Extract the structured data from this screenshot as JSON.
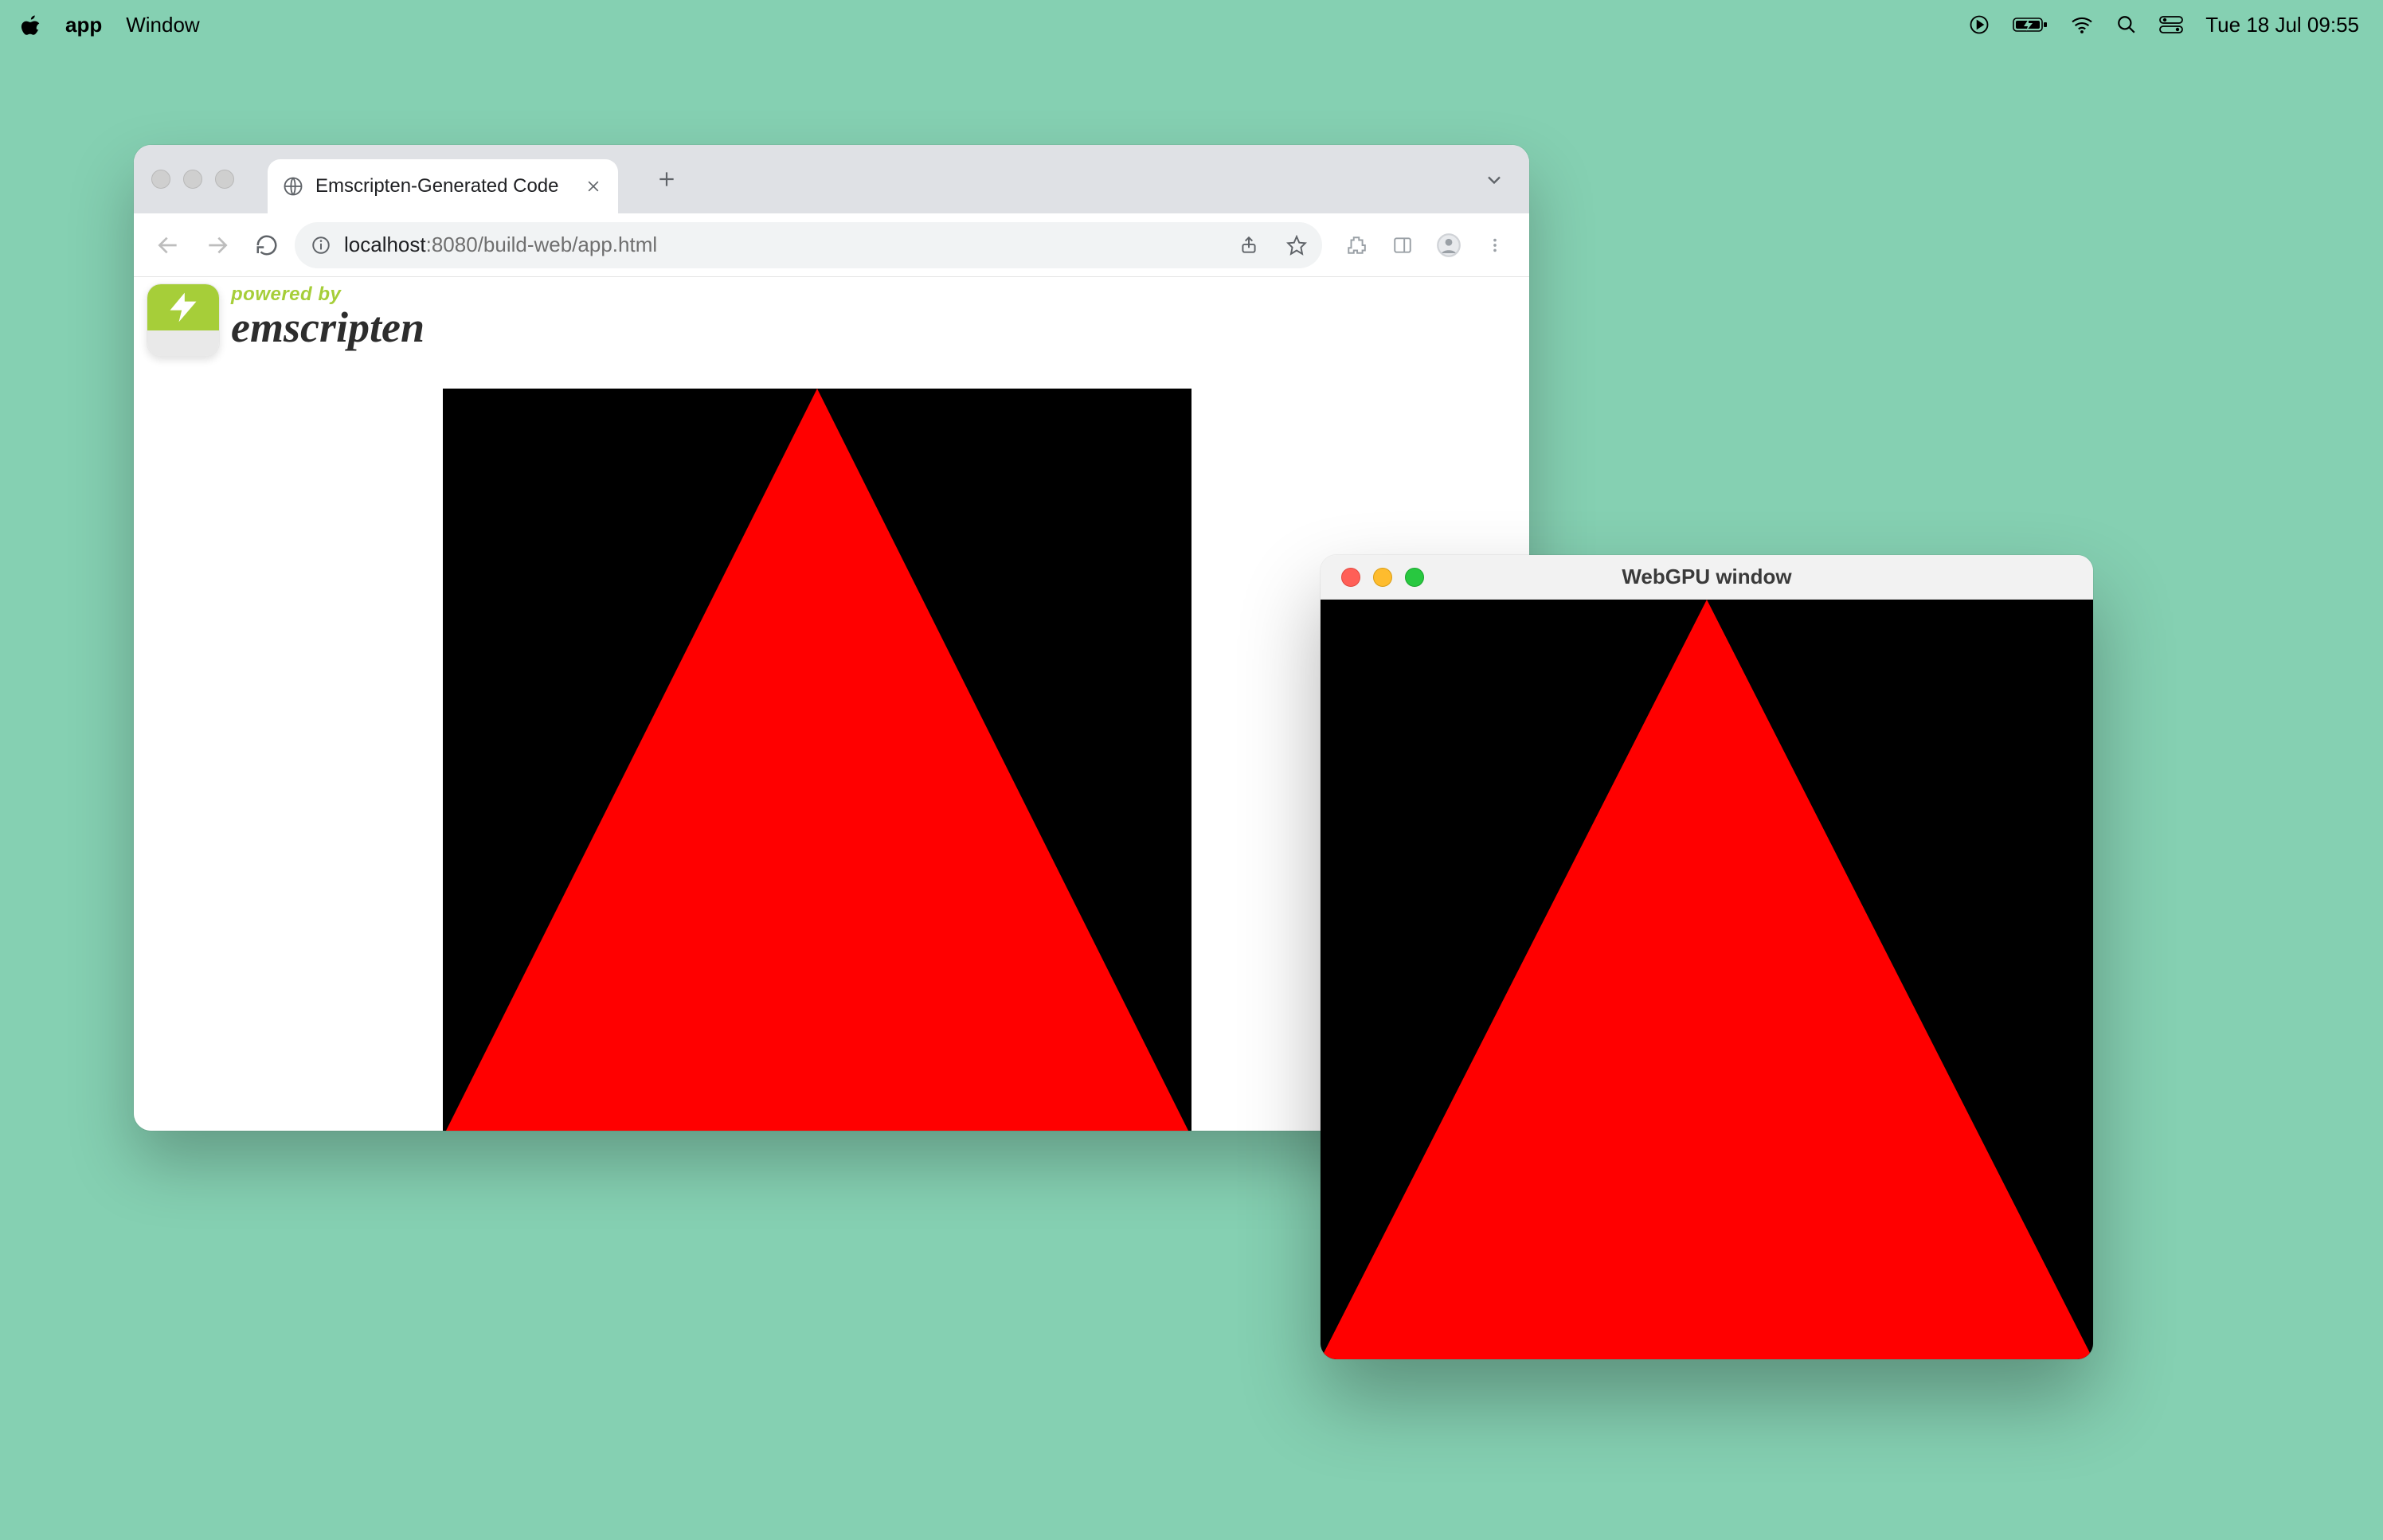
{
  "menubar": {
    "app_name": "app",
    "menus": [
      "Window"
    ],
    "clock": "Tue 18 Jul  09:55"
  },
  "browser": {
    "tab_title": "Emscripten-Generated Code",
    "url_host": "localhost",
    "url_rest": ":8080/build-web/app.html",
    "logo_powered_by": "powered by",
    "logo_name": "emscripten"
  },
  "native": {
    "title": "WebGPU window"
  },
  "colors": {
    "desktop_bg": "#85d0b2",
    "triangle_fill": "#ff0000",
    "canvas_bg": "#000000"
  }
}
